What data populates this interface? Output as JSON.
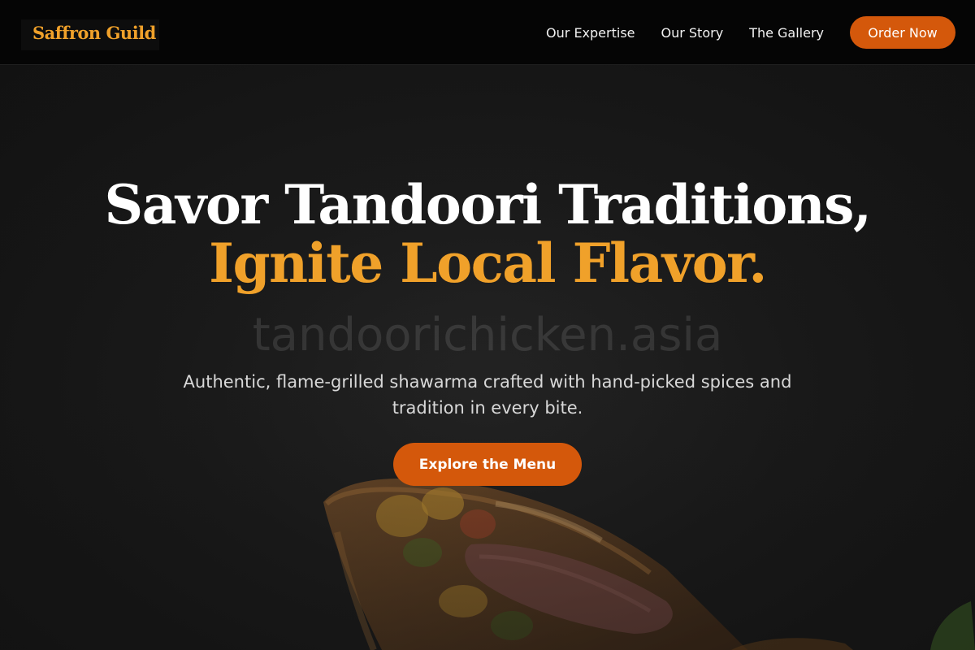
{
  "colors": {
    "brand_gold": "#f0a12a",
    "accent_orange": "#d4580b",
    "nav_background": "#050505",
    "hero_background": "#1a1a1a",
    "heading_white": "#ffffff"
  },
  "nav": {
    "brand": "Saffron Guild",
    "links": [
      "Our Expertise",
      "Our Story",
      "The Gallery"
    ],
    "cta": "Order Now"
  },
  "hero": {
    "watermark": "tandoorichicken.asia",
    "headline_white": "Savor Tandoori Traditions, ",
    "headline_accent": "Ignite Local Flavor.",
    "subtext": "Authentic, flame-grilled shawarma crafted with hand-picked spices and tradition in every bite.",
    "cta": "Explore the Menu",
    "image": "shawarma-wrap-photo"
  }
}
